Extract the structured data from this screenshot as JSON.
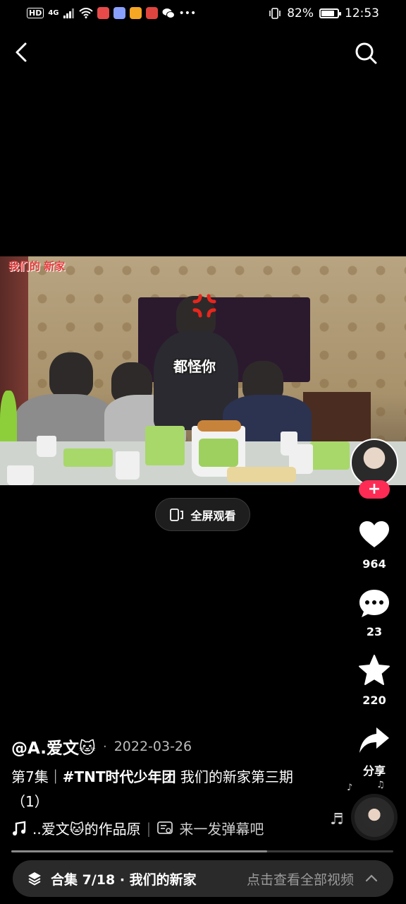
{
  "status_bar": {
    "hd": "HD",
    "network": "4G",
    "battery_percent": "82%",
    "battery_level": 0.82,
    "time": "12:53"
  },
  "nav": {
    "back_icon": "back-arrow-icon",
    "search_icon": "search-icon"
  },
  "video": {
    "watermark": "我们的 新家",
    "sticker_text": "都怪你"
  },
  "fullscreen": {
    "label": "全屏观看"
  },
  "rail": {
    "like_count": "964",
    "comment_count": "23",
    "favorite_count": "220",
    "share_label": "分享",
    "follow_symbol": "+"
  },
  "post": {
    "author": "@A.爱文🐱",
    "date": "2022-03-26",
    "desc_prefix": "第7集｜",
    "desc_hashtag": "#TNT时代少年团",
    "desc_rest": " 我们的新家第三期（1）",
    "music_text": "..爱文🐱的作品原",
    "danmu_text": "来一发弹幕吧"
  },
  "progress": 0.67,
  "collection": {
    "title": "合集 7/18 · 我们的新家",
    "cta": "点击查看全部视频"
  },
  "colors": {
    "accent": "#fe2c55",
    "background": "#000000"
  }
}
